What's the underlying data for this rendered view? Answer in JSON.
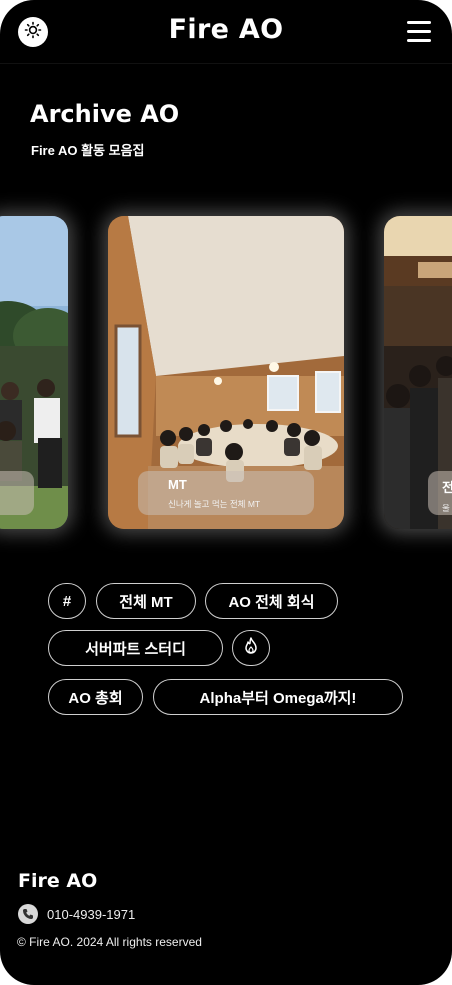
{
  "header": {
    "title": "Fire AO",
    "theme_icon": "sun-icon",
    "menu_icon": "hamburger-menu-icon"
  },
  "hero": {
    "title": "Archive AO",
    "subtitle": "Fire AO 활동 모음집"
  },
  "carousel": {
    "main": {
      "title": "MT",
      "description": "신나게 놀고 먹는 전체 MT"
    },
    "right": {
      "title": "전",
      "description": "울"
    }
  },
  "tags": {
    "hash": "#",
    "all_mt": "전체 MT",
    "ao_dinner": "AO 전체 회식",
    "server_study": "서버파트 스터디",
    "fire_icon": "fire-icon",
    "ao_general": "AO 총회",
    "alpha_omega": "Alpha부터 Omega까지!"
  },
  "footer": {
    "brand": "Fire AO",
    "phone": "010-4939-1971",
    "phone_icon": "phone-icon",
    "copyright": "© Fire AO. 2024 All rights reserved"
  },
  "colors": {
    "background": "#000000",
    "text": "#ffffff",
    "tag_border": "#cfcfcf"
  }
}
